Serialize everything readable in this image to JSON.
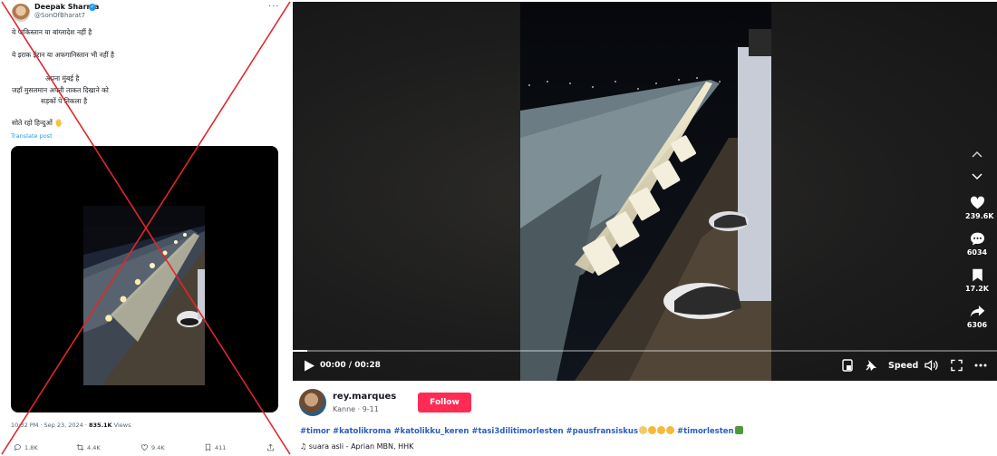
{
  "tweet": {
    "display_name": "Deepak Sharma",
    "handle": "@SonOfBharat7",
    "more": "···",
    "lines": [
      "ये पाकिस्तान या बांग्लादेश नहीं है",
      "ये इराक ईरान या अफगानिस्तान भी नहीं है",
      "अपना मुंबई है",
      "जहाँ मुसलमान अपनी ताकत दिखाने को",
      "सड़कों पे निकला है",
      "सोते रहो हिन्दुओं 🖐"
    ],
    "translate": "Translate post",
    "time": "10:32 PM · Sep 23, 2024 · ",
    "views_count": "835.1K",
    "views_label": " Views",
    "replies": "1.8K",
    "reposts": "4.4K",
    "likes": "9.4K",
    "bookmarks": "411"
  },
  "player": {
    "time": "00:00 / 00:28",
    "speed": "Speed",
    "progress": 0.02,
    "likes": "239.6K",
    "comments": "6034",
    "saves": "17.2K",
    "shares": "6306"
  },
  "post": {
    "username": "rey.marques",
    "subline": "Kanne · 9-11",
    "follow": "Follow",
    "hashtags": "#timor #katolikroma #katolikku_keren #tasi3dilitimorlesten #pausfransiskus",
    "hashtag_end": " #timorlesten",
    "music": "♫ suara asli - Aprian MBN, HHK"
  },
  "colors": {
    "accent": "#fe2c55",
    "link": "#1d9bf0",
    "hashtag": "#2b5db9",
    "cross": "#e0262a"
  }
}
